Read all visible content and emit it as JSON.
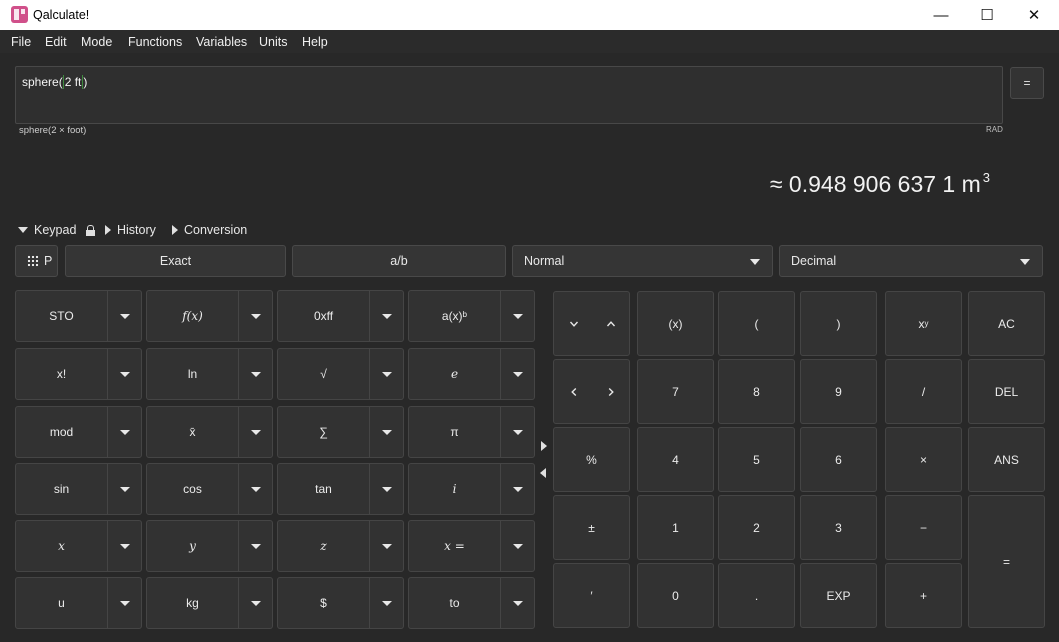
{
  "window": {
    "title": "Qalculate!",
    "minimize": "—",
    "maximize": "☐",
    "close": "✕"
  },
  "menu": [
    "File",
    "Edit",
    "Mode",
    "Functions",
    "Variables",
    "Units",
    "Help"
  ],
  "expression": {
    "func": "sphere",
    "arg": "2 ft",
    "equals": "=",
    "parsed": "sphere(2 × foot)",
    "angle_mode": "RAD"
  },
  "result": {
    "text": "≈ 0.948 906 637 1 m",
    "exponent": "3"
  },
  "expanders": {
    "keypad": "Keypad",
    "history": "History",
    "conversion": "Conversion"
  },
  "controls": {
    "programming": "P",
    "exact": "Exact",
    "fraction": "a/b",
    "display_mode": "Normal",
    "base": "Decimal"
  },
  "left_keys": [
    [
      "STO",
      "f(x)",
      "0xff",
      "a(x)ᵇ"
    ],
    [
      "x!",
      "ln",
      "√",
      "e"
    ],
    [
      "mod",
      "x̄",
      "∑",
      "π"
    ],
    [
      "sin",
      "cos",
      "tan",
      "i"
    ],
    [
      "x",
      "y",
      "z",
      "x ="
    ],
    [
      "u",
      "kg",
      "$",
      "to"
    ]
  ],
  "right_keys": {
    "row1": [
      "(x)",
      "(",
      ")",
      "x",
      "AC"
    ],
    "row1_sup": "y",
    "row2": [
      "7",
      "8",
      "9",
      "/",
      "DEL"
    ],
    "row3": [
      "%",
      "4",
      "5",
      "6",
      "×",
      "ANS"
    ],
    "row4": [
      "±",
      "1",
      "2",
      "3",
      "−",
      "="
    ],
    "row5": [
      "′",
      "0",
      ".",
      "EXP",
      "+"
    ]
  }
}
